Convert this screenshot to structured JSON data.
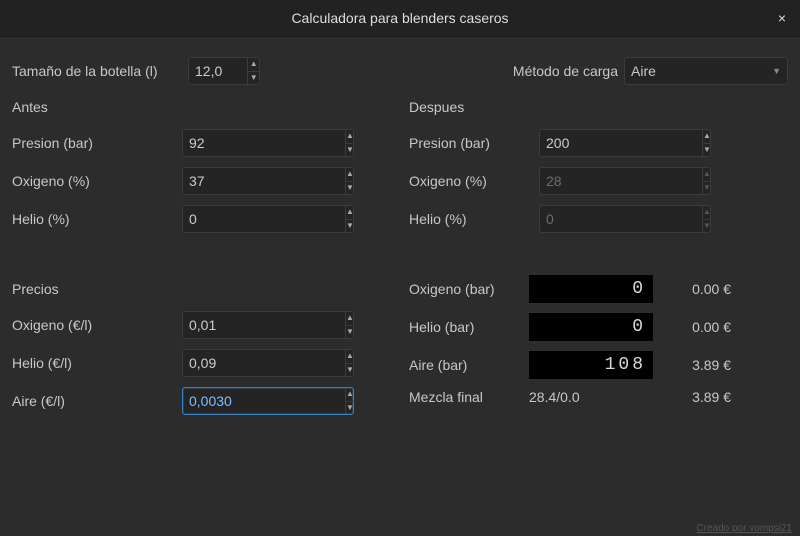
{
  "title": "Calculadora para blenders caseros",
  "close_label": "×",
  "bottle_size_label": "Tamaño de la botella (l)",
  "bottle_size_value": "12,0",
  "fill_method_label": "Método de carga",
  "fill_method_value": "Aire",
  "before_label": "Antes",
  "after_label": "Despues",
  "rows_labels": {
    "pressure": "Presion (bar)",
    "oxygen": "Oxigeno (%)",
    "helium": "Helio (%)"
  },
  "before": {
    "pressure": "92",
    "oxygen": "37",
    "helium": "0"
  },
  "after": {
    "pressure": "200",
    "oxygen": "28",
    "helium": "0"
  },
  "prices_label": "Precios",
  "price_rows": {
    "oxygen_l": "Oxigeno (€/l)",
    "helium_l": "Helio (€/l)",
    "air_l": "Aire (€/l)"
  },
  "prices": {
    "oxygen": "0,01",
    "helium": "0,09",
    "air": "0,0030"
  },
  "result_rows": {
    "oxygen_bar": "Oxigeno (bar)",
    "helium_bar": "Helio (bar)",
    "air_bar": "Aire (bar)",
    "final_mix": "Mezcla final"
  },
  "results": {
    "oxygen_bar": "0",
    "oxygen_cost": "0.00 €",
    "helium_bar": "0",
    "helium_cost": "0.00 €",
    "air_bar": "108",
    "air_cost": "3.89 €",
    "final_mix": "28.4/0.0",
    "final_cost": "3.89 €"
  },
  "footer": "Creado por vompsi21"
}
